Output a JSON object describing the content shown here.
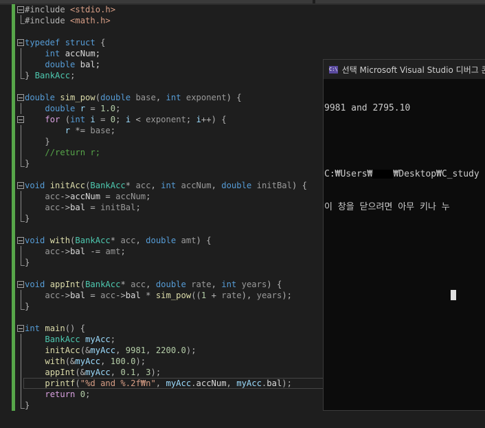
{
  "editor": {
    "current_line": 35,
    "lines": [
      {
        "fold": "open",
        "tokens": [
          [
            "o",
            "#include "
          ],
          [
            "s",
            "<stdio.h>"
          ]
        ]
      },
      {
        "fold": "end",
        "tokens": [
          [
            "o",
            "#include "
          ],
          [
            "s",
            "<math.h>"
          ]
        ]
      },
      {
        "fold": "",
        "tokens": []
      },
      {
        "fold": "open",
        "tokens": [
          [
            "k",
            "typedef struct "
          ],
          [
            "o",
            "{"
          ]
        ]
      },
      {
        "fold": "mid",
        "tokens": [
          [
            "m",
            "    "
          ],
          [
            "k",
            "int "
          ],
          [
            "m",
            "accNum;"
          ]
        ]
      },
      {
        "fold": "mid",
        "tokens": [
          [
            "m",
            "    "
          ],
          [
            "k",
            "double "
          ],
          [
            "m",
            "bal;"
          ]
        ]
      },
      {
        "fold": "end",
        "tokens": [
          [
            "o",
            "} "
          ],
          [
            "t",
            "BankAcc"
          ],
          [
            "o",
            ";"
          ]
        ]
      },
      {
        "fold": "",
        "tokens": []
      },
      {
        "fold": "open",
        "tokens": [
          [
            "k",
            "double "
          ],
          [
            "f",
            "sim_pow"
          ],
          [
            "o",
            "("
          ],
          [
            "k",
            "double "
          ],
          [
            "p",
            "base"
          ],
          [
            "o",
            ", "
          ],
          [
            "k",
            "int "
          ],
          [
            "p",
            "exponent"
          ],
          [
            "o",
            ") {"
          ]
        ]
      },
      {
        "fold": "mid",
        "tokens": [
          [
            "m",
            "    "
          ],
          [
            "k",
            "double "
          ],
          [
            "v",
            "r"
          ],
          [
            "o",
            " = "
          ],
          [
            "n",
            "1.0"
          ],
          [
            "o",
            ";"
          ]
        ]
      },
      {
        "fold": "open",
        "tokens": [
          [
            "m",
            "    "
          ],
          [
            "x",
            "for "
          ],
          [
            "o",
            "("
          ],
          [
            "k",
            "int "
          ],
          [
            "v",
            "i"
          ],
          [
            "o",
            " = "
          ],
          [
            "n",
            "0"
          ],
          [
            "o",
            "; "
          ],
          [
            "v",
            "i"
          ],
          [
            "o",
            " < "
          ],
          [
            "p",
            "exponent"
          ],
          [
            "o",
            "; "
          ],
          [
            "v",
            "i"
          ],
          [
            "o",
            "++) {"
          ]
        ]
      },
      {
        "fold": "mid",
        "tokens": [
          [
            "m",
            "        "
          ],
          [
            "v",
            "r"
          ],
          [
            "o",
            " *= "
          ],
          [
            "p",
            "base"
          ],
          [
            "o",
            ";"
          ]
        ]
      },
      {
        "fold": "mid",
        "tokens": [
          [
            "m",
            "    "
          ],
          [
            "o",
            "}"
          ]
        ]
      },
      {
        "fold": "mid",
        "tokens": [
          [
            "m",
            "    "
          ],
          [
            "c",
            "//return r;"
          ]
        ]
      },
      {
        "fold": "end",
        "tokens": [
          [
            "o",
            "}"
          ]
        ]
      },
      {
        "fold": "",
        "tokens": []
      },
      {
        "fold": "open",
        "tokens": [
          [
            "k",
            "void "
          ],
          [
            "f",
            "initAcc"
          ],
          [
            "o",
            "("
          ],
          [
            "t",
            "BankAcc"
          ],
          [
            "o",
            "* "
          ],
          [
            "p",
            "acc"
          ],
          [
            "o",
            ", "
          ],
          [
            "k",
            "int "
          ],
          [
            "p",
            "accNum"
          ],
          [
            "o",
            ", "
          ],
          [
            "k",
            "double "
          ],
          [
            "p",
            "initBal"
          ],
          [
            "o",
            ") {"
          ]
        ]
      },
      {
        "fold": "mid",
        "tokens": [
          [
            "m",
            "    "
          ],
          [
            "p",
            "acc"
          ],
          [
            "o",
            "->"
          ],
          [
            "m",
            "accNum"
          ],
          [
            "o",
            " = "
          ],
          [
            "p",
            "accNum"
          ],
          [
            "o",
            ";"
          ]
        ]
      },
      {
        "fold": "mid",
        "tokens": [
          [
            "m",
            "    "
          ],
          [
            "p",
            "acc"
          ],
          [
            "o",
            "->"
          ],
          [
            "m",
            "bal"
          ],
          [
            "o",
            " = "
          ],
          [
            "p",
            "initBal"
          ],
          [
            "o",
            ";"
          ]
        ]
      },
      {
        "fold": "end",
        "tokens": [
          [
            "o",
            "}"
          ]
        ]
      },
      {
        "fold": "",
        "tokens": []
      },
      {
        "fold": "open",
        "tokens": [
          [
            "k",
            "void "
          ],
          [
            "f",
            "with"
          ],
          [
            "o",
            "("
          ],
          [
            "t",
            "BankAcc"
          ],
          [
            "o",
            "* "
          ],
          [
            "p",
            "acc"
          ],
          [
            "o",
            ", "
          ],
          [
            "k",
            "double "
          ],
          [
            "p",
            "amt"
          ],
          [
            "o",
            ") {"
          ]
        ]
      },
      {
        "fold": "mid",
        "tokens": [
          [
            "m",
            "    "
          ],
          [
            "p",
            "acc"
          ],
          [
            "o",
            "->"
          ],
          [
            "m",
            "bal"
          ],
          [
            "o",
            " -= "
          ],
          [
            "p",
            "amt"
          ],
          [
            "o",
            ";"
          ]
        ]
      },
      {
        "fold": "end",
        "tokens": [
          [
            "o",
            "}"
          ]
        ]
      },
      {
        "fold": "",
        "tokens": []
      },
      {
        "fold": "open",
        "tokens": [
          [
            "k",
            "void "
          ],
          [
            "f",
            "appInt"
          ],
          [
            "o",
            "("
          ],
          [
            "t",
            "BankAcc"
          ],
          [
            "o",
            "* "
          ],
          [
            "p",
            "acc"
          ],
          [
            "o",
            ", "
          ],
          [
            "k",
            "double "
          ],
          [
            "p",
            "rate"
          ],
          [
            "o",
            ", "
          ],
          [
            "k",
            "int "
          ],
          [
            "p",
            "years"
          ],
          [
            "o",
            ") {"
          ]
        ]
      },
      {
        "fold": "mid",
        "tokens": [
          [
            "m",
            "    "
          ],
          [
            "p",
            "acc"
          ],
          [
            "o",
            "->"
          ],
          [
            "m",
            "bal"
          ],
          [
            "o",
            " = "
          ],
          [
            "p",
            "acc"
          ],
          [
            "o",
            "->"
          ],
          [
            "m",
            "bal"
          ],
          [
            "o",
            " * "
          ],
          [
            "f",
            "sim_pow"
          ],
          [
            "o",
            "(("
          ],
          [
            "n",
            "1"
          ],
          [
            "o",
            " + "
          ],
          [
            "p",
            "rate"
          ],
          [
            "o",
            "), "
          ],
          [
            "p",
            "years"
          ],
          [
            "o",
            ");"
          ]
        ]
      },
      {
        "fold": "end",
        "tokens": [
          [
            "o",
            "}"
          ]
        ]
      },
      {
        "fold": "",
        "tokens": []
      },
      {
        "fold": "open",
        "tokens": [
          [
            "k",
            "int "
          ],
          [
            "f",
            "main"
          ],
          [
            "o",
            "() {"
          ]
        ]
      },
      {
        "fold": "mid",
        "tokens": [
          [
            "m",
            "    "
          ],
          [
            "t",
            "BankAcc "
          ],
          [
            "v",
            "myAcc"
          ],
          [
            "o",
            ";"
          ]
        ]
      },
      {
        "fold": "mid",
        "tokens": [
          [
            "m",
            "    "
          ],
          [
            "f",
            "initAcc"
          ],
          [
            "o",
            "(&"
          ],
          [
            "v",
            "myAcc"
          ],
          [
            "o",
            ", "
          ],
          [
            "n",
            "9981"
          ],
          [
            "o",
            ", "
          ],
          [
            "n",
            "2200.0"
          ],
          [
            "o",
            ");"
          ]
        ]
      },
      {
        "fold": "mid",
        "tokens": [
          [
            "m",
            "    "
          ],
          [
            "f",
            "with"
          ],
          [
            "o",
            "(&"
          ],
          [
            "v",
            "myAcc"
          ],
          [
            "o",
            ", "
          ],
          [
            "n",
            "100.0"
          ],
          [
            "o",
            ");"
          ]
        ]
      },
      {
        "fold": "mid",
        "tokens": [
          [
            "m",
            "    "
          ],
          [
            "f",
            "appInt"
          ],
          [
            "o",
            "(&"
          ],
          [
            "v",
            "myAcc"
          ],
          [
            "o",
            ", "
          ],
          [
            "n",
            "0.1"
          ],
          [
            "o",
            ", "
          ],
          [
            "n",
            "3"
          ],
          [
            "o",
            ");"
          ]
        ]
      },
      {
        "fold": "mid",
        "tokens": [
          [
            "m",
            "    "
          ],
          [
            "f",
            "printf"
          ],
          [
            "o",
            "("
          ],
          [
            "s",
            "\"%d and %.2f₩n\""
          ],
          [
            "o",
            ", "
          ],
          [
            "v",
            "myAcc"
          ],
          [
            "o",
            "."
          ],
          [
            "m",
            "accNum"
          ],
          [
            "o",
            ", "
          ],
          [
            "v",
            "myAcc"
          ],
          [
            "o",
            "."
          ],
          [
            "m",
            "bal"
          ],
          [
            "o",
            ");"
          ]
        ]
      },
      {
        "fold": "mid",
        "tokens": [
          [
            "m",
            "    "
          ],
          [
            "x",
            "return "
          ],
          [
            "n",
            "0"
          ],
          [
            "o",
            ";"
          ]
        ]
      },
      {
        "fold": "end",
        "tokens": [
          [
            "o",
            "}"
          ]
        ]
      }
    ]
  },
  "console": {
    "icon_label": "C:\\",
    "title": "선택 Microsoft Visual Studio 디버그 콘",
    "output_line": "9981 and 2795.10",
    "path_prefix": "C:₩Users₩",
    "path_suffix": "₩Desktop₩C_study",
    "prompt_line": "이 창을 닫으려면 아무 키나 누"
  },
  "colors": {
    "accent_change_bar": "#57a64a",
    "editor_bg": "#1e1e1e",
    "console_bg": "#0c0c0c"
  }
}
